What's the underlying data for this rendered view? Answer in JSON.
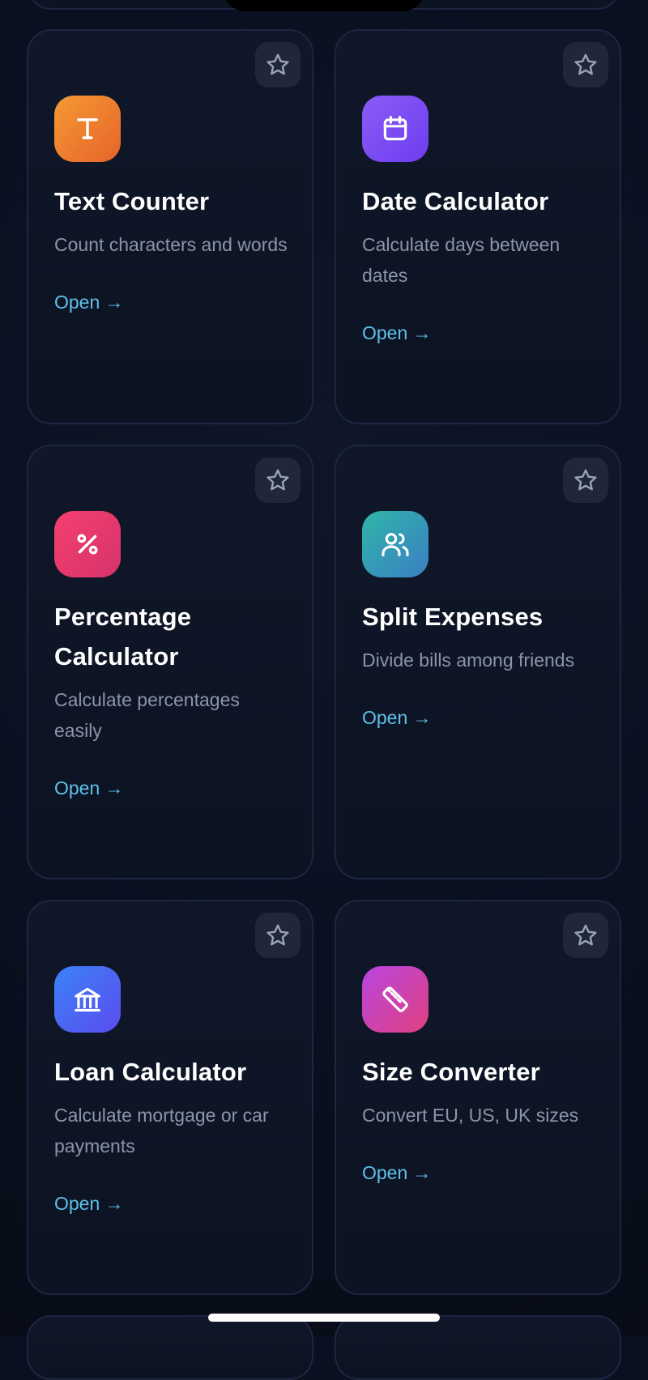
{
  "cards": [
    {
      "title": "Text Counter",
      "description": "Count characters and words",
      "link": "Open →",
      "icon": "text-icon",
      "icon_color": "#f08a30"
    },
    {
      "title": "Date Calculator",
      "description": "Calculate days between dates",
      "link": "Open →",
      "icon": "calendar-icon",
      "icon_color": "#7c4dff"
    },
    {
      "title": "Percentage Calculator",
      "description": "Calculate percentages easily",
      "link": "Open →",
      "icon": "percent-icon",
      "icon_color": "#ea3a6c"
    },
    {
      "title": "Split Expenses",
      "description": "Divide bills among friends",
      "link": "Open →",
      "icon": "users-icon",
      "icon_color": "#3a9eb6"
    },
    {
      "title": "Loan Calculator",
      "description": "Calculate mortgage or car payments",
      "link": "Open →",
      "icon": "bank-icon",
      "icon_color": "#4a6cf7"
    },
    {
      "title": "Size Converter",
      "description": "Convert EU, US, UK sizes",
      "link": "Open →",
      "icon": "ruler-icon",
      "icon_color": "#cc44b0"
    }
  ],
  "colors": {
    "background": "#0a1020",
    "card_border": "#1d2640",
    "link": "#5fc0ea",
    "description": "#8c95a8",
    "star_button": "#1f2738"
  }
}
